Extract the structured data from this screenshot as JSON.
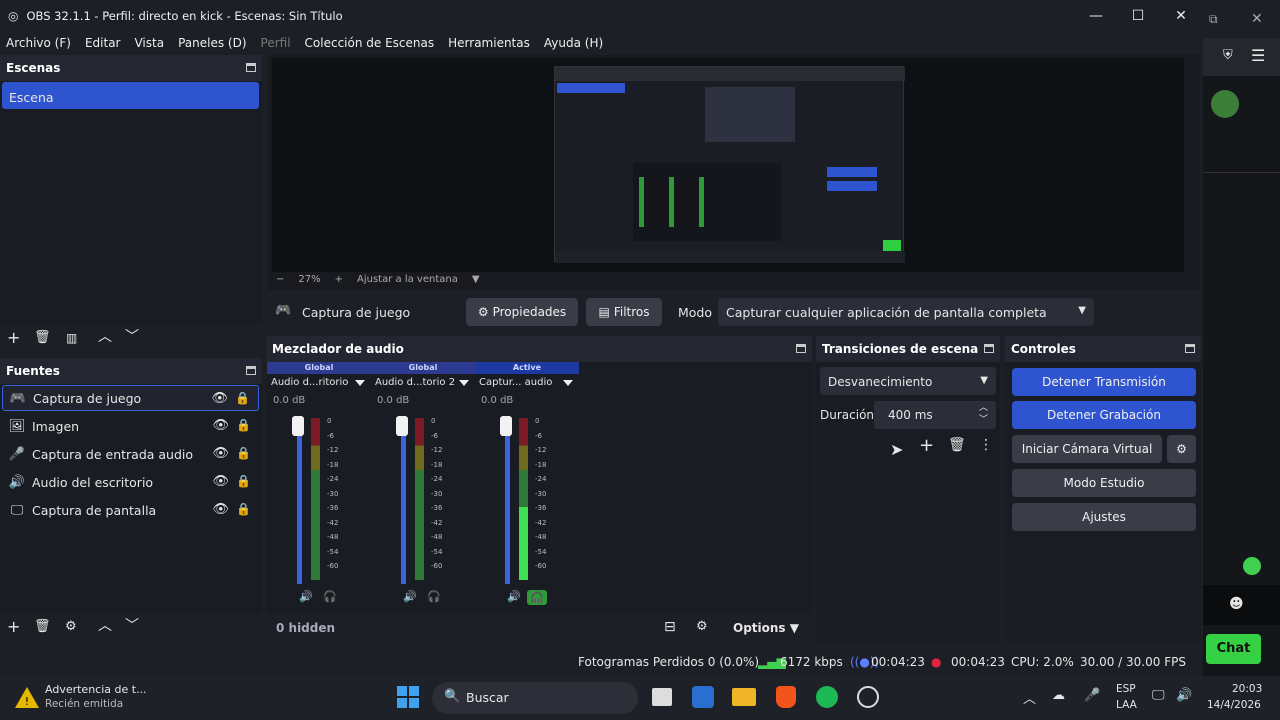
{
  "window": {
    "title": "OBS 32.1.1 - Perfil: directo en kick - Escenas: Sin Título",
    "min": "—",
    "max": "☐",
    "close": "✕"
  },
  "menu": [
    "Archivo (F)",
    "Editar",
    "Vista",
    "Paneles (D)",
    "Perfil",
    "Colección de Escenas",
    "Herramientas",
    "Ayuda (H)"
  ],
  "scenes": {
    "title": "Escenas",
    "items": [
      "Escena"
    ]
  },
  "preview": {
    "zoom": "27%",
    "fit_label": "Ajustar a la ventana",
    "minus": "−",
    "plus": "+"
  },
  "source_bar": {
    "name": "Captura de juego",
    "properties": "Propiedades",
    "filters": "Filtros",
    "mode_label": "Modo",
    "mode_value": "Capturar cualquier aplicación de pantalla completa"
  },
  "sources": {
    "title": "Fuentes",
    "items": [
      {
        "label": "Captura de juego",
        "icon": "gamepad-icon",
        "glyph": "🎮"
      },
      {
        "label": "Imagen",
        "icon": "image-icon",
        "glyph": "🖼"
      },
      {
        "label": "Captura de entrada audio",
        "icon": "microphone-icon",
        "glyph": "🎤"
      },
      {
        "label": "Audio del escritorio",
        "icon": "speaker-icon",
        "glyph": "🔊"
      },
      {
        "label": "Captura de pantalla",
        "icon": "monitor-icon",
        "glyph": "🖵"
      }
    ]
  },
  "mixer": {
    "title": "Mezclador de audio",
    "hidden": "0 hidden",
    "options": "Options",
    "channels": [
      {
        "header": "Global",
        "name": "Audio d...ritorio",
        "db": "0.0 dB",
        "level": 0
      },
      {
        "header": "Global",
        "name": "Audio d...torio 2",
        "db": "0.0 dB",
        "level": 0
      },
      {
        "header": "Active",
        "name": "Captur... audio",
        "db": "0.0 dB",
        "level": 0.45
      }
    ],
    "scale": [
      "0",
      "-6",
      "-12",
      "-18",
      "-24",
      "-30",
      "-36",
      "-42",
      "-48",
      "-54",
      "-60"
    ]
  },
  "transitions": {
    "title": "Transiciones de escena",
    "selected": "Desvanecimiento",
    "duration_label": "Duración",
    "duration_value": "400 ms"
  },
  "controls": {
    "title": "Controles",
    "stop_stream": "Detener Transmisión",
    "stop_rec": "Detener Grabación",
    "virtual_cam": "Iniciar Cámara Virtual",
    "studio": "Modo Estudio",
    "settings": "Ajustes"
  },
  "status": {
    "dropped": "Fotogramas Perdidos 0 (0.0%)",
    "bitrate": "6172 kbps",
    "stream_time": "00:04:23",
    "rec_time": "00:04:23",
    "cpu": "CPU: 2.0%",
    "fps": "30.00 / 30.00 FPS"
  },
  "taskbar": {
    "notif_title": "Advertencia de t...",
    "notif_sub": "Recién emitida",
    "search": "Buscar",
    "lang1": "ESP",
    "lang2": "LAA",
    "time": "20:03",
    "date": "14/4/2026"
  },
  "side": {
    "chat": "Chat"
  }
}
